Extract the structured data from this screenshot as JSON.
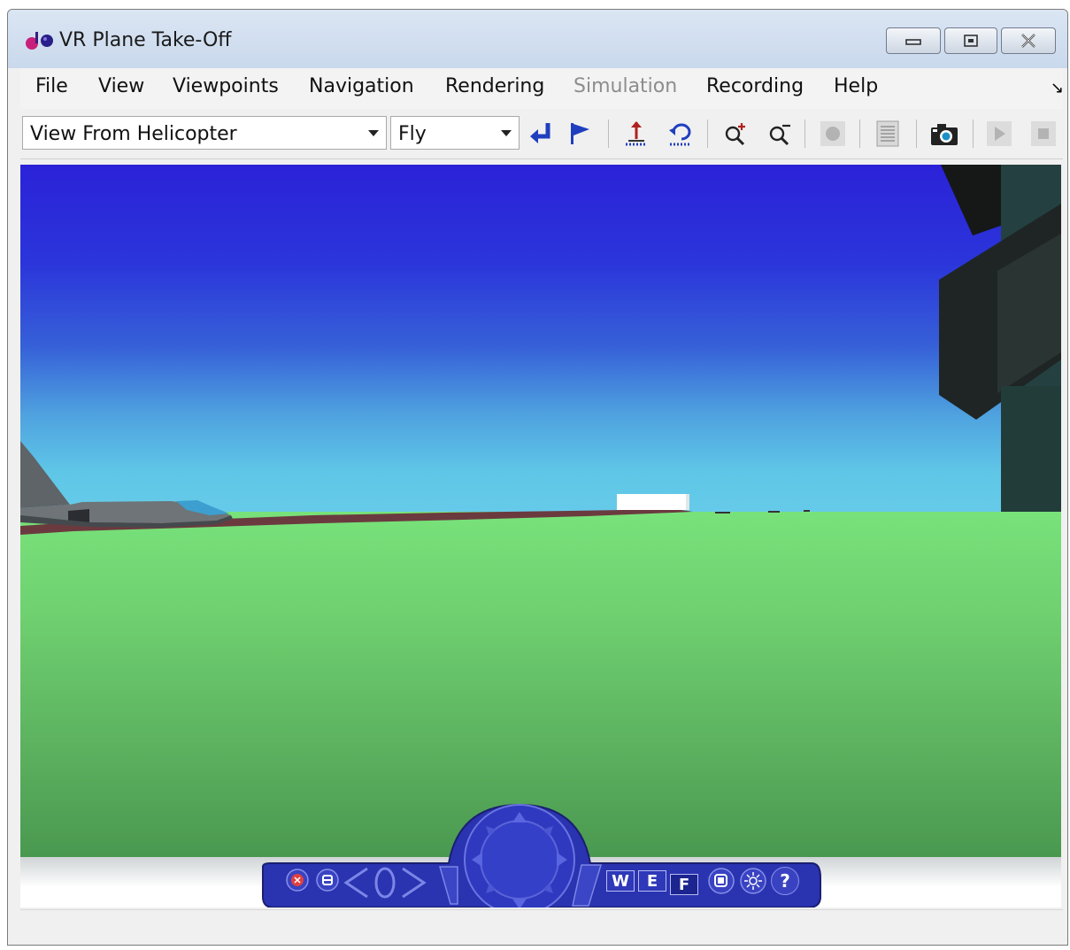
{
  "window": {
    "title": "VR Plane Take-Off"
  },
  "menu": {
    "items": [
      {
        "label": "File",
        "enabled": true
      },
      {
        "label": "View",
        "enabled": true
      },
      {
        "label": "Viewpoints",
        "enabled": true
      },
      {
        "label": "Navigation",
        "enabled": true
      },
      {
        "label": "Rendering",
        "enabled": true
      },
      {
        "label": "Simulation",
        "enabled": false
      },
      {
        "label": "Recording",
        "enabled": true
      },
      {
        "label": "Help",
        "enabled": true
      }
    ]
  },
  "toolbar": {
    "viewpoint_value": "View From Helicopter",
    "navigation_mode_value": "Fly"
  },
  "nav_panel": {
    "wireframe_label": "W",
    "examine_label": "E",
    "fly_label": "F",
    "help_label": "?"
  },
  "colors": {
    "sky_top": "#2b22d8",
    "sky_horizon": "#66cbe9",
    "ground": "#6fd070",
    "nav_panel": "#2a33b0"
  },
  "icons": [
    "app-icon",
    "minimize-icon",
    "maximize-icon",
    "close-icon",
    "go-to-default-viewpoint-icon",
    "create-viewpoint-icon",
    "straighten-up-icon",
    "undo-move-icon",
    "zoom-in-icon",
    "zoom-out-icon",
    "record-icon",
    "recording-settings-icon",
    "capture-frame-icon",
    "play-icon",
    "stop-icon"
  ]
}
